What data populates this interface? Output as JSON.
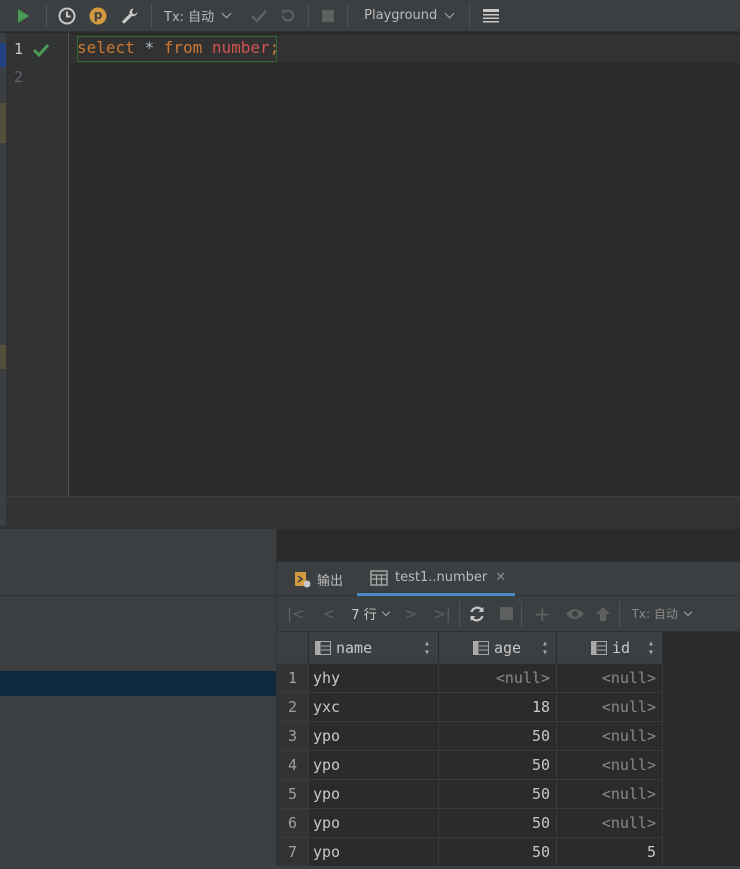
{
  "toolbar": {
    "tx_label": "Tx: 自动",
    "playground_label": "Playground",
    "profile_letter": "p"
  },
  "editor": {
    "line_numbers": [
      "1",
      "2"
    ],
    "tokens": {
      "select": "select",
      "star": "*",
      "from": "from",
      "table": "number",
      "semicolon": ";"
    }
  },
  "results": {
    "tabs": {
      "output": "输出",
      "table": "test1..number"
    },
    "row_count": "7 行",
    "tx_label": "Tx: 自动",
    "columns": [
      "name",
      "age",
      "id"
    ],
    "rows": [
      {
        "num": "1",
        "name": "yhy",
        "age": "<null>",
        "id": "<null>"
      },
      {
        "num": "2",
        "name": "yxc",
        "age": "18",
        "id": "<null>"
      },
      {
        "num": "3",
        "name": "ypo",
        "age": "50",
        "id": "<null>"
      },
      {
        "num": "4",
        "name": "ypo",
        "age": "50",
        "id": "<null>"
      },
      {
        "num": "5",
        "name": "ypo",
        "age": "50",
        "id": "<null>"
      },
      {
        "num": "6",
        "name": "ypo",
        "age": "50",
        "id": "<null>"
      },
      {
        "num": "7",
        "name": "ypo",
        "age": "50",
        "id": "5"
      }
    ]
  },
  "colors": {
    "run_green": "#499c54",
    "keyword": "#cc7832",
    "table_red": "#d25252",
    "accent_blue": "#4a88c7",
    "selection": "#0d293e"
  }
}
